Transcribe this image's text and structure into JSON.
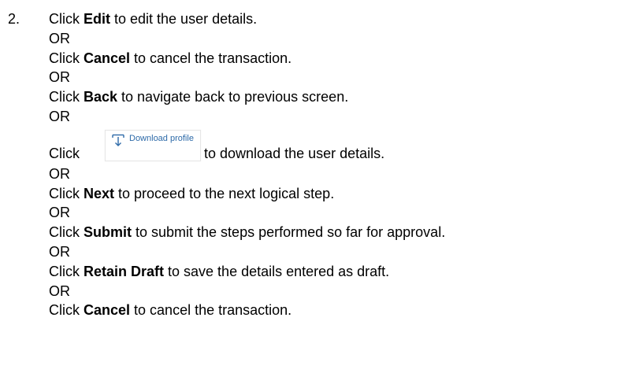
{
  "step": {
    "number": "2.",
    "lines": {
      "l1": {
        "pre": "Click ",
        "bold": "Edit",
        "post": " to edit the user details."
      },
      "or1": "OR",
      "l2": {
        "pre": "Click ",
        "bold": "Cancel",
        "post": " to cancel the transaction."
      },
      "or2": "OR",
      "l3": {
        "pre": "Click ",
        "bold": "Back",
        "post": " to navigate back to previous screen."
      },
      "or3": "OR",
      "l4": {
        "pre": "Click",
        "button_label": "Download profile",
        "post": "to download the user details."
      },
      "or4": "OR",
      "l5": {
        "pre": "Click ",
        "bold": "Next",
        "post": " to proceed to the next logical step."
      },
      "or5": "OR",
      "l6": {
        "pre": "Click ",
        "bold": "Submit",
        "post": " to submit the steps performed so far for approval."
      },
      "or6": "OR",
      "l7": {
        "pre": "Click ",
        "bold": "Retain Draft",
        "post": " to save the details entered as draft."
      },
      "or7": "OR",
      "l8": {
        "pre": "Click ",
        "bold": "Cancel",
        "post": " to cancel the transaction."
      }
    }
  },
  "icons": {
    "download": "download-icon"
  },
  "colors": {
    "button_text": "#2d6aa8",
    "button_border": "#e6e6e6"
  }
}
